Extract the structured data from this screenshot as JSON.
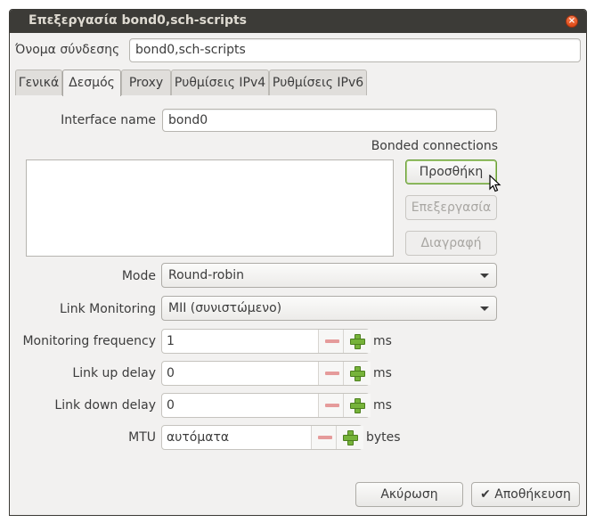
{
  "window": {
    "title": "Επεξεργασία bond0,sch-scripts"
  },
  "connection": {
    "name_label": "Όνομα σύνδεσης",
    "name_value": "bond0,sch-scripts"
  },
  "tabs": [
    {
      "label": "Γενικά"
    },
    {
      "label": "Δεσμός"
    },
    {
      "label": "Proxy"
    },
    {
      "label": "Ρυθμίσεις IPv4"
    },
    {
      "label": "Ρυθμίσεις IPv6"
    }
  ],
  "bond": {
    "interface_name_label": "Interface name",
    "interface_name_value": "bond0",
    "bonded_connections_label": "Bonded connections",
    "add_button": "Προσθήκη",
    "edit_button": "Επεξεργασία",
    "delete_button": "Διαγραφή",
    "mode_label": "Mode",
    "mode_value": "Round-robin",
    "link_monitoring_label": "Link Monitoring",
    "link_monitoring_value": "MII (συνιστώμενο)",
    "monitoring_frequency_label": "Monitoring frequency",
    "monitoring_frequency_value": "1",
    "monitoring_frequency_unit": "ms",
    "link_up_delay_label": "Link up delay",
    "link_up_delay_value": "0",
    "link_up_delay_unit": "ms",
    "link_down_delay_label": "Link down delay",
    "link_down_delay_value": "0",
    "link_down_delay_unit": "ms",
    "mtu_label": "MTU",
    "mtu_value": "αυτόματα",
    "mtu_unit": "bytes"
  },
  "footer": {
    "cancel_button": "Ακύρωση",
    "save_button": "Αποθήκευση",
    "save_icon": "check-icon"
  }
}
